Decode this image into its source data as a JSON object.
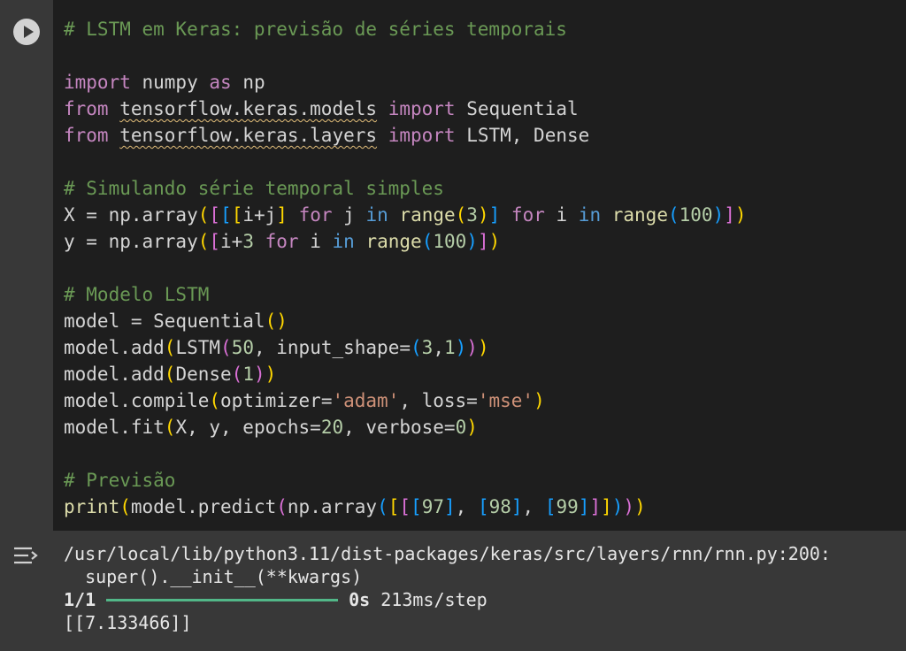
{
  "cell": {
    "run_button_icon": "play-icon",
    "output_icon": "output-toggle-icon"
  },
  "code": {
    "comment1": "# LSTM em Keras: previsão de séries temporais",
    "l2": {
      "kw1": "import",
      "mod": " numpy ",
      "kw2": "as",
      "alias": " np"
    },
    "l3": {
      "kw1": "from",
      "mod": "tensorflow.keras.models",
      "kw2": "import",
      "name": " Sequential"
    },
    "l4": {
      "kw1": "from",
      "mod": "tensorflow.keras.layers",
      "kw2": "import",
      "name": " LSTM, Dense"
    },
    "comment2": "# Simulando série temporal simples",
    "l6": "X = np.array([[[i+j] for j in range(3)] for i in range(100)])",
    "l7": "y = np.array([i+3 for i in range(100)])",
    "comment3": "# Modelo LSTM",
    "l9": "model = Sequential()",
    "l10": "model.add(LSTM(50, input_shape=(3,1)))",
    "l11": "model.add(Dense(1))",
    "l12": "model.compile(optimizer='adam', loss='mse')",
    "l13": "model.fit(X, y, epochs=20, verbose=0)",
    "comment4": "# Previsão",
    "l15": "print(model.predict(np.array([[[97], [98], [99]]])))"
  },
  "output": {
    "warning_path": "/usr/local/lib/python3.11/dist-packages/keras/src/layers/rnn/rnn.py:200:",
    "warning_detail": "  super().__init__(**kwargs)",
    "progress_step": "1/1",
    "progress_value": 1.0,
    "progress_time": "0s",
    "progress_rate": " 213ms/step",
    "result": "[[7.133466]]"
  },
  "colors": {
    "editor_bg": "#1e1e1e",
    "cell_bg": "#383838",
    "progress": "#52b788"
  }
}
